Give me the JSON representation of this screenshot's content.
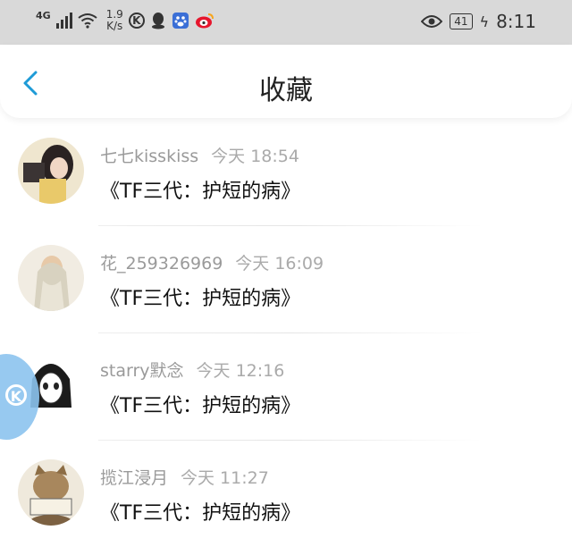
{
  "status_bar": {
    "network": "4G",
    "speed_value": "1.9",
    "speed_unit": "K/s",
    "k_icon": "K",
    "battery": "41",
    "time": "8:11"
  },
  "header": {
    "title": "收藏"
  },
  "favorites": [
    {
      "username": "七七kisskiss",
      "time": "今天 18:54",
      "message": "《TF三代：护短的病》"
    },
    {
      "username": "花_259326969",
      "time": "今天 16:09",
      "message": "《TF三代：护短的病》"
    },
    {
      "username": "starry默念",
      "time": "今天 12:16",
      "message": "《TF三代：护短的病》"
    },
    {
      "username": "揽江浸月",
      "time": "今天 11:27",
      "message": "《TF三代：护短的病》"
    }
  ],
  "colors": {
    "accent": "#1e9bd7",
    "statusbar": "#d9d9d9"
  }
}
